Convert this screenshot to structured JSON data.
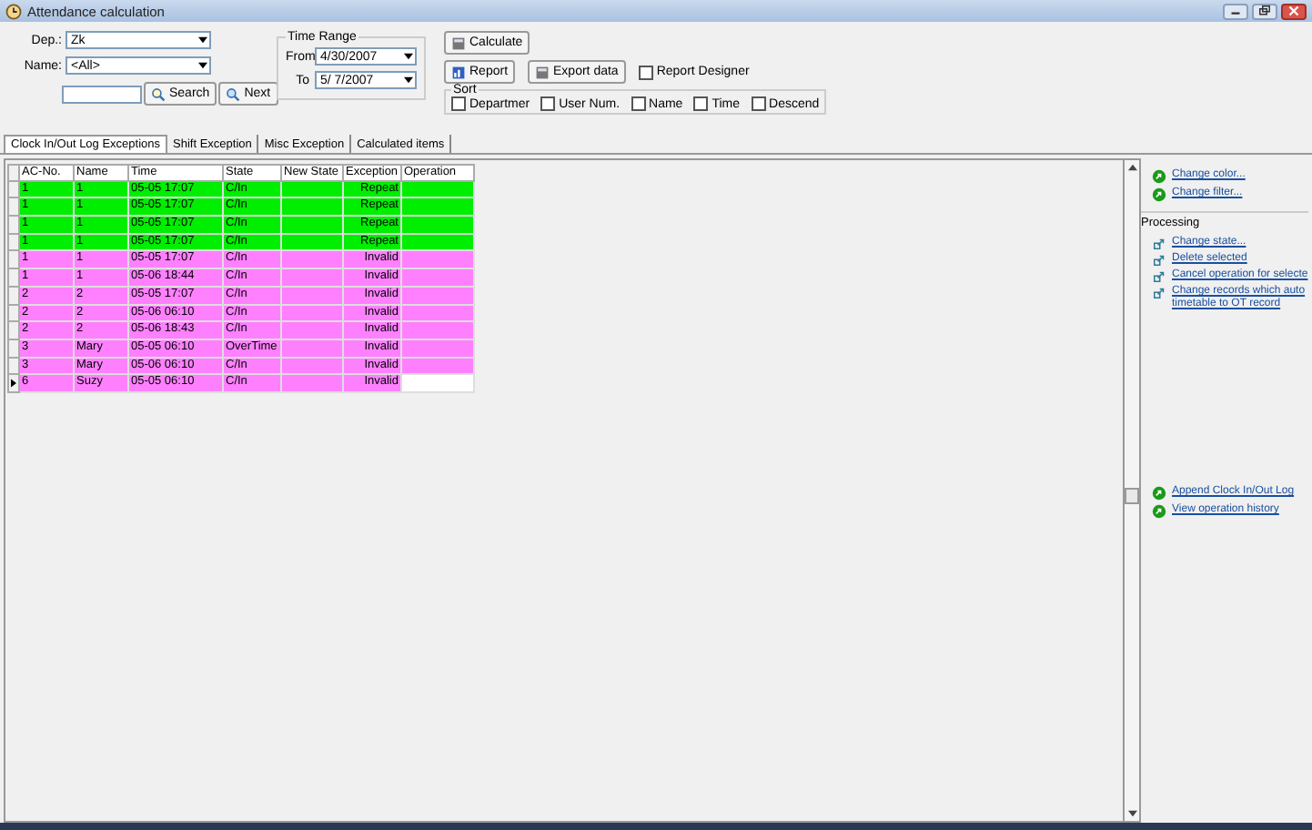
{
  "window": {
    "title": "Attendance calculation"
  },
  "filters": {
    "dep_label": "Dep.:",
    "dep_value": "Zk",
    "name_label": "Name:",
    "name_value": "<All>",
    "search_button": "Search",
    "next_button": "Next"
  },
  "time_range": {
    "title": "Time Range",
    "from_label": "From",
    "from_value": "4/30/2007",
    "to_label": "To",
    "to_value": "5/ 7/2007"
  },
  "actions": {
    "calculate": "Calculate",
    "report": "Report",
    "export": "Export data",
    "report_designer": {
      "label": "Report Designer",
      "checked": false
    }
  },
  "sort": {
    "title": "Sort",
    "options": [
      {
        "label": "Departmer",
        "checked": false
      },
      {
        "label": "User Num.",
        "checked": false
      },
      {
        "label": "Name",
        "checked": false
      },
      {
        "label": "Time",
        "checked": false
      },
      {
        "label": "Descend",
        "checked": false
      }
    ]
  },
  "tabs": [
    {
      "label": "Clock In/Out Log Exceptions",
      "selected": true
    },
    {
      "label": "Shift Exception",
      "selected": false
    },
    {
      "label": "Misc Exception",
      "selected": false
    },
    {
      "label": "Calculated items",
      "selected": false
    }
  ],
  "table": {
    "columns": [
      "AC-No.",
      "Name",
      "Time",
      "State",
      "New State",
      "Exception",
      "Operation"
    ],
    "rows": [
      {
        "cells": [
          "1",
          "1",
          "05-05 17:07",
          "C/In",
          "",
          "Repeat",
          ""
        ],
        "color": "#00ee00",
        "selected": false
      },
      {
        "cells": [
          "1",
          "1",
          "05-05 17:07",
          "C/In",
          "",
          "Repeat",
          ""
        ],
        "color": "#00ee00",
        "selected": false
      },
      {
        "cells": [
          "1",
          "1",
          "05-05 17:07",
          "C/In",
          "",
          "Repeat",
          ""
        ],
        "color": "#00ee00",
        "selected": false
      },
      {
        "cells": [
          "1",
          "1",
          "05-05 17:07",
          "C/In",
          "",
          "Repeat",
          ""
        ],
        "color": "#00ee00",
        "selected": false
      },
      {
        "cells": [
          "1",
          "1",
          "05-05 17:07",
          "C/In",
          "",
          "Invalid",
          ""
        ],
        "color": "#ff80ff",
        "selected": false
      },
      {
        "cells": [
          "1",
          "1",
          "05-06 18:44",
          "C/In",
          "",
          "Invalid",
          ""
        ],
        "color": "#ff80ff",
        "selected": false
      },
      {
        "cells": [
          "2",
          "2",
          "05-05 17:07",
          "C/In",
          "",
          "Invalid",
          ""
        ],
        "color": "#ff80ff",
        "selected": false
      },
      {
        "cells": [
          "2",
          "2",
          "05-06 06:10",
          "C/In",
          "",
          "Invalid",
          ""
        ],
        "color": "#ff80ff",
        "selected": false
      },
      {
        "cells": [
          "2",
          "2",
          "05-06 18:43",
          "C/In",
          "",
          "Invalid",
          ""
        ],
        "color": "#ff80ff",
        "selected": false
      },
      {
        "cells": [
          "3",
          "Mary",
          "05-05 06:10",
          "OverTime",
          "",
          "Invalid",
          ""
        ],
        "color": "#ff80ff",
        "selected": false
      },
      {
        "cells": [
          "3",
          "Mary",
          "05-06 06:10",
          "C/In",
          "",
          "Invalid",
          ""
        ],
        "color": "#ff80ff",
        "selected": false
      },
      {
        "cells": [
          "6",
          "Suzy",
          "05-05 06:10",
          "C/In",
          "",
          "Invalid",
          ""
        ],
        "color": "#ff80ff",
        "selected": true
      }
    ]
  },
  "side_panel": {
    "top_links": [
      "Change color...",
      "Change filter..."
    ],
    "processing_title": "Processing",
    "processing_links": [
      "Change state...",
      "Delete selected",
      "Cancel operation for selecte",
      "Change records which auto timetable to OT record"
    ],
    "bottom_links": [
      "Append Clock In/Out Log",
      "View operation history"
    ]
  }
}
